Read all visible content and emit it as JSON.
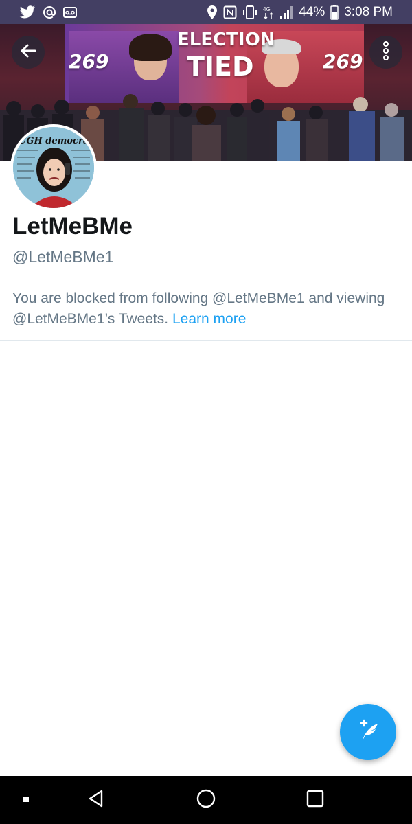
{
  "status_bar": {
    "battery_percent": "44%",
    "time": "3:08 PM",
    "left_icons": [
      "twitter-icon",
      "at-sign-icon",
      "voicemail-icon"
    ],
    "right_icons": [
      "location-icon",
      "nfc-icon",
      "vibrate-icon",
      "data-transfer-icon",
      "signal-icon",
      "battery-icon"
    ],
    "background": "#433f63"
  },
  "banner": {
    "headline_top": "ELECTION",
    "headline_bottom": "TIED",
    "left_score": "269",
    "right_score": "269",
    "back_icon": "arrow-left-icon",
    "overflow_icon": "more-vertical-icon"
  },
  "avatar": {
    "art_text": "UGH democracy"
  },
  "profile": {
    "display_name": "LetMeBMe",
    "handle": "@LetMeBMe1"
  },
  "blocked_notice": {
    "message": "You are blocked from following @LetMeBMe1 and viewing @LetMeBMe1’s Tweets.",
    "link_text": "Learn more"
  },
  "fab": {
    "icon": "compose-tweet-icon",
    "color": "#1da1f2"
  },
  "nav_bar": {
    "icons": [
      "recents-dot-icon",
      "back-triangle-icon",
      "home-circle-icon",
      "overview-square-icon"
    ]
  },
  "colors": {
    "accent": "#1da1f2",
    "text_primary": "#14171a",
    "text_secondary": "#657786",
    "divider": "#e1e8ed"
  }
}
